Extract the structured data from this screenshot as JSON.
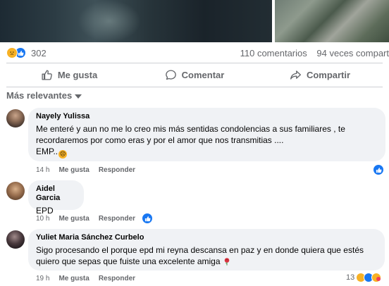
{
  "post": {
    "reaction_count": "302",
    "comments_count": "110 comentarios",
    "shares_count": "94 veces compart"
  },
  "actions": {
    "like_label": "Me gusta",
    "comment_label": "Comentar",
    "share_label": "Compartir"
  },
  "sort": {
    "label": "Más relevantes"
  },
  "comments": [
    {
      "author": "Nayely Yulissa",
      "line1": "Me enteré y aun no me lo creo mis más sentidas condolencias a sus familiares , te",
      "line2": "recordaremos por como eras y por el amor que nos transmitias ....",
      "line3": "EMP..",
      "time": "14 h",
      "like": "Me gusta",
      "reply": "Responder"
    },
    {
      "author": "Aidel Garcia",
      "line1": "EPD",
      "time": "10 h",
      "like": "Me gusta",
      "reply": "Responder"
    },
    {
      "author": "Yuliet Maria Sánchez Curbelo",
      "line1": "Sigo procesando el porque epd mi reyna descansa en paz y en donde quiera que estés",
      "line2": "quiero que sepas que fuiste una excelente amiga",
      "time": "19 h",
      "like": "Me gusta",
      "reply": "Responder",
      "reaction_count": "13"
    }
  ],
  "colors": {
    "accent": "#1877f2",
    "secondary_text": "#65676b",
    "bubble": "#f0f2f5"
  }
}
